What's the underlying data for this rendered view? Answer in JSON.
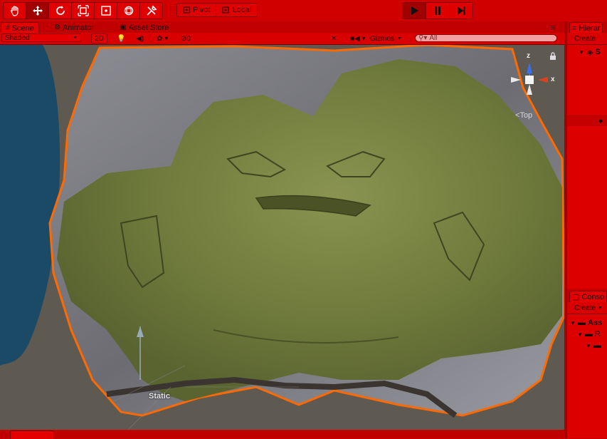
{
  "toolbar": {
    "tools": [
      {
        "icon": "hand-icon",
        "active": false
      },
      {
        "icon": "move-icon",
        "active": true
      },
      {
        "icon": "rotate-icon",
        "active": false
      },
      {
        "icon": "scale-icon",
        "active": false
      },
      {
        "icon": "rect-icon",
        "active": false
      },
      {
        "icon": "transform-icon",
        "active": false
      },
      {
        "icon": "custom-tool-icon",
        "active": false
      }
    ],
    "pivot_label": "Pivot",
    "local_label": "Local",
    "play": {
      "play_icon": "play-icon",
      "pause_icon": "pause-icon",
      "step_icon": "step-icon"
    }
  },
  "scene_panel": {
    "tabs": [
      {
        "label": "Scene",
        "icon": "scene-icon",
        "active": true
      },
      {
        "label": "Animator",
        "icon": "animator-icon",
        "active": false
      },
      {
        "label": "Asset Store",
        "icon": "store-icon",
        "active": false
      }
    ],
    "bar": {
      "shading_mode": "Shaded",
      "mode_2d": "2D",
      "effects_count": "0",
      "gizmos_label": "Gizmos",
      "search_placeholder": "All"
    },
    "viewport": {
      "static_label": "Static",
      "gizmo_axes": {
        "z": "z",
        "x": "x"
      },
      "gizmo_view": "Top"
    }
  },
  "hierarchy": {
    "tab_label": "Hierar",
    "create_label": "Create",
    "scene_label": "S"
  },
  "project": {
    "tab_label": "Conso",
    "create_label": "Create",
    "assets_label": "Ass",
    "folder_label": "R"
  },
  "bottom": {
    "tabs": [
      "",
      ""
    ]
  },
  "colors": {
    "play_mode_tint": "#cc0000",
    "selection_outline": "#ff6a00",
    "water": "#1b4a66",
    "grass": "#7b8745"
  }
}
